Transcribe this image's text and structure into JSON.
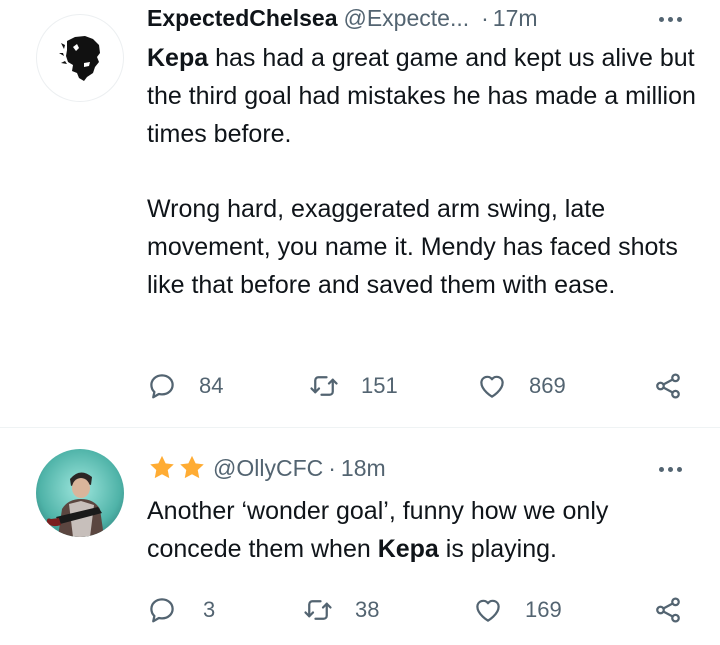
{
  "tweets": [
    {
      "display_name": "ExpectedChelsea",
      "handle": "@Expecte...",
      "separator": "·",
      "time": "17m",
      "avatar_icon": "lion-head-logo",
      "paragraphs": [
        [
          {
            "text": "Kepa",
            "bold": true
          },
          {
            "text": " has had a great game and kept us alive but the third goal had mistakes he has made a million times before.",
            "bold": false
          }
        ],
        [
          {
            "text": "Wrong hard, exaggerated arm swing, late movement, you name it. Mendy has faced shots like that before and saved them with ease.",
            "bold": false
          }
        ]
      ],
      "actions": {
        "replies": "84",
        "retweets": "151",
        "likes": "869"
      }
    },
    {
      "name_emoji": "⭐⭐",
      "handle": "@OllyCFC",
      "separator": "·",
      "time": "18m",
      "avatar_icon": "user-photo-avatar",
      "paragraphs": [
        [
          {
            "text": "Another ‘wonder goal’, funny how we only concede them when ",
            "bold": false
          },
          {
            "text": "Kepa",
            "bold": true
          },
          {
            "text": " is playing.",
            "bold": false
          }
        ]
      ],
      "actions": {
        "replies": "3",
        "retweets": "38",
        "likes": "169"
      }
    }
  ],
  "icons": {
    "reply": "speech-bubble-icon",
    "retweet": "retweet-arrows-icon",
    "like": "heart-icon",
    "share": "share-nodes-icon",
    "more": "ellipsis-icon"
  },
  "colors": {
    "text_primary": "#0f1419",
    "text_secondary": "#536471",
    "star": "#ffac33",
    "divider": "#eff3f4"
  }
}
